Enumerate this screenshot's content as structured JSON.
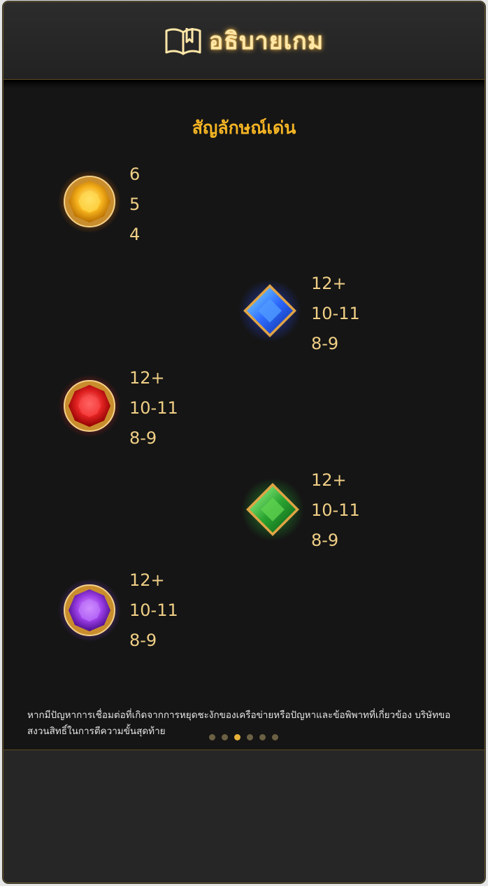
{
  "header": {
    "title": "อธิบายเกม",
    "icon": "book-icon"
  },
  "section": {
    "title": "สัญลักษณ์เด่น"
  },
  "symbols": [
    {
      "name": "yellow-gem",
      "color": "#f6b21c",
      "payouts": [
        "6",
        "5",
        "4"
      ]
    },
    {
      "name": "blue-gem",
      "color": "#2f6bff",
      "payouts": [
        "12+",
        "10-11",
        "8-9"
      ]
    },
    {
      "name": "red-gem",
      "color": "#e32222",
      "payouts": [
        "12+",
        "10-11",
        "8-9"
      ]
    },
    {
      "name": "green-gem",
      "color": "#2aa431",
      "payouts": [
        "12+",
        "10-11",
        "8-9"
      ]
    },
    {
      "name": "purple-gem",
      "color": "#9b3ee6",
      "payouts": [
        "12+",
        "10-11",
        "8-9"
      ]
    }
  ],
  "disclaimer": "หากมีปัญหาการเชื่อมต่อที่เกิดจากการหยุดชะงักของเครือข่ายหรือปัญหาและข้อพิพาทที่เกี่ยวข้อง บริษัทขอสงวนสิทธิ์ในการตีความขั้นสุดท้าย",
  "pagination": {
    "total": 6,
    "current": 3
  }
}
